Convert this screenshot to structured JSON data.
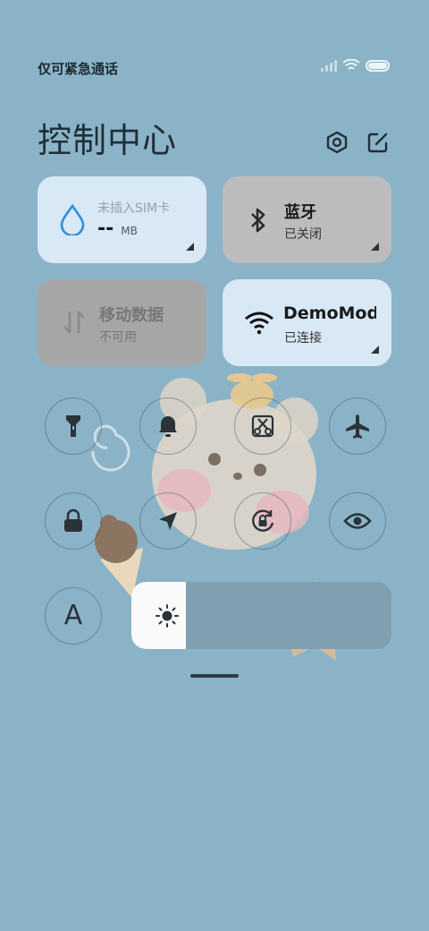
{
  "status_bar": {
    "carrier_text": "仅可紧急通话",
    "signal_icon": "signal-icon",
    "wifi_icon": "wifi-icon",
    "battery_icon": "battery-icon"
  },
  "header": {
    "title": "控制中心",
    "settings_icon": "gear-icon",
    "edit_icon": "edit-icon"
  },
  "tiles": {
    "sim": {
      "title": "未插入SIM卡",
      "value": "--",
      "unit": "MB",
      "icon": "water-drop-icon"
    },
    "bluetooth": {
      "title": "蓝牙",
      "status": "已关闭",
      "icon": "bluetooth-icon"
    },
    "mobile_data": {
      "title": "移动数据",
      "status": "不可用",
      "icon": "data-arrows-icon"
    },
    "wifi": {
      "title": "DemoMod",
      "status": "已连接",
      "icon": "wifi-icon"
    }
  },
  "toggles": [
    {
      "name": "flashlight",
      "icon": "flashlight-icon"
    },
    {
      "name": "mute",
      "icon": "bell-icon"
    },
    {
      "name": "screenshot",
      "icon": "scissors-icon"
    },
    {
      "name": "airplane",
      "icon": "airplane-icon"
    },
    {
      "name": "lock",
      "icon": "lock-icon"
    },
    {
      "name": "location",
      "icon": "location-arrow-icon"
    },
    {
      "name": "rotation-lock",
      "icon": "rotation-lock-icon"
    },
    {
      "name": "reading-mode",
      "icon": "eye-icon"
    },
    {
      "name": "font",
      "icon": "font-a-icon",
      "label": "A"
    }
  ],
  "brightness": {
    "level": 0.21,
    "icon": "sun-icon"
  },
  "colors": {
    "background": "#8bb3c8",
    "tile_active": "#d8e8f5",
    "tile_inactive": "#bcbcbc"
  }
}
